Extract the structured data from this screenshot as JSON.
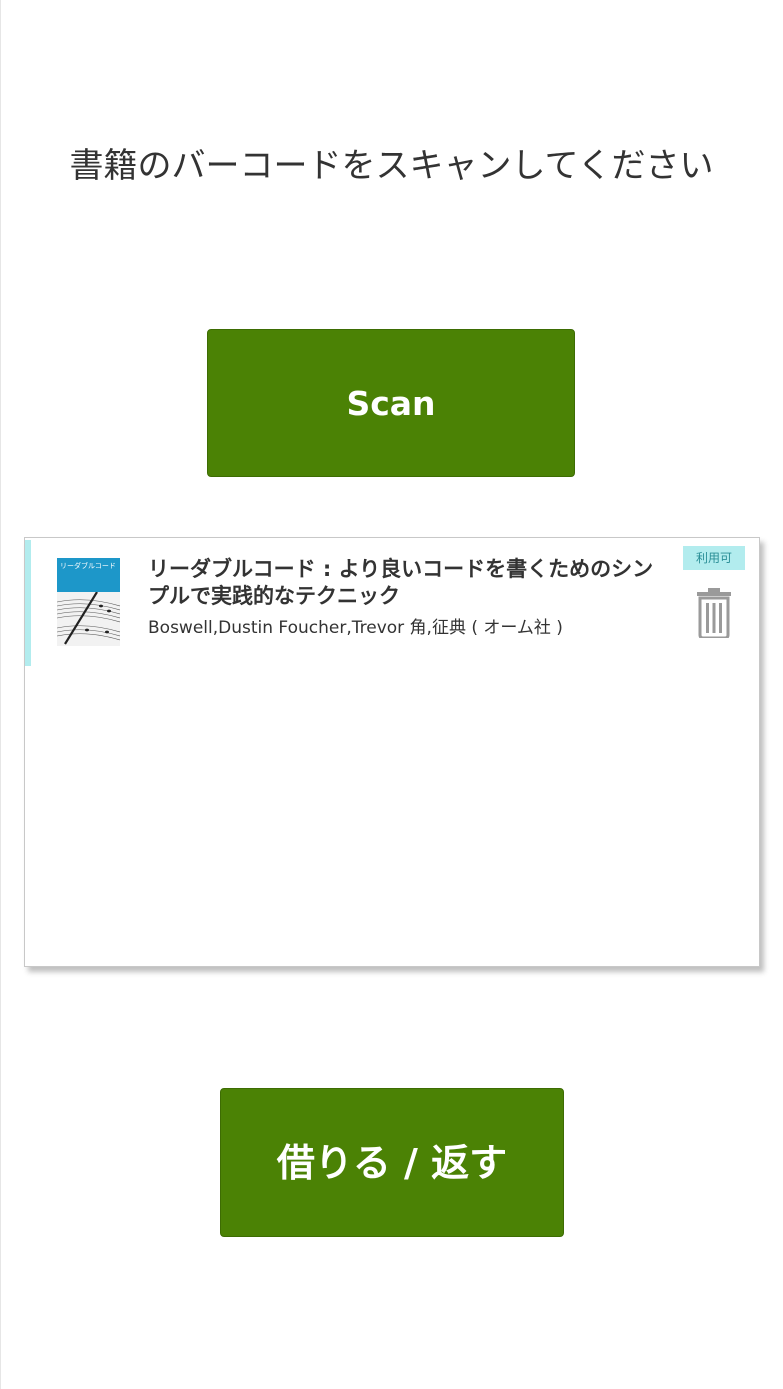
{
  "instruction": "書籍のバーコードをスキャンしてください",
  "scan_button": {
    "label": "Scan"
  },
  "books": [
    {
      "title": "リーダブルコード : より良いコードを書くためのシンプルで実践的なテクニック",
      "authors": "Boswell,Dustin Foucher,Trevor 角,征典 ( オーム社 )",
      "status": "利用可",
      "cover_text": "リーダブルコード",
      "cover_icon": "book-cover-image",
      "delete_icon": "trash-icon"
    }
  ],
  "action_button": {
    "label": "借りる / 返す"
  },
  "colors": {
    "primary_button": "#4b8205",
    "status_badge_bg": "#b2ecee",
    "status_badge_text": "#2a8e96",
    "accent_bar": "#b2ecee",
    "trash_icon": "#9a9a9a"
  }
}
